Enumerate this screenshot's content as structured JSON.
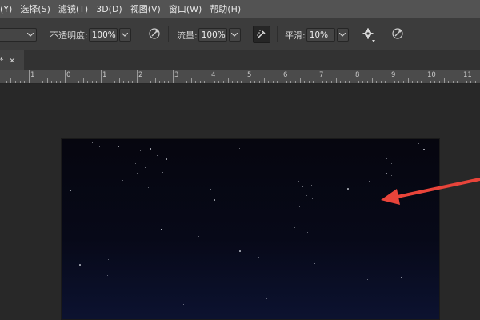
{
  "menu": [
    "(Y)",
    "选择(S)",
    "滤镜(T)",
    "3D(D)",
    "视图(V)",
    "窗口(W)",
    "帮助(H)"
  ],
  "options": {
    "opacity_label": "不透明度:",
    "opacity_value": "100%",
    "flow_label": "流量:",
    "flow_value": "100%",
    "smoothing_label": "平滑:",
    "smoothing_value": "10%"
  },
  "tab": {
    "close": "×",
    "modified": "*"
  },
  "ruler_numbers": [
    "1",
    "0",
    "1",
    "2",
    "3",
    "4",
    "5",
    "6",
    "7",
    "8",
    "9",
    "10",
    "11"
  ],
  "colors": {
    "arrow": "#e8443a",
    "sky_top": "#06060f",
    "sky_bottom": "#0c1230"
  }
}
